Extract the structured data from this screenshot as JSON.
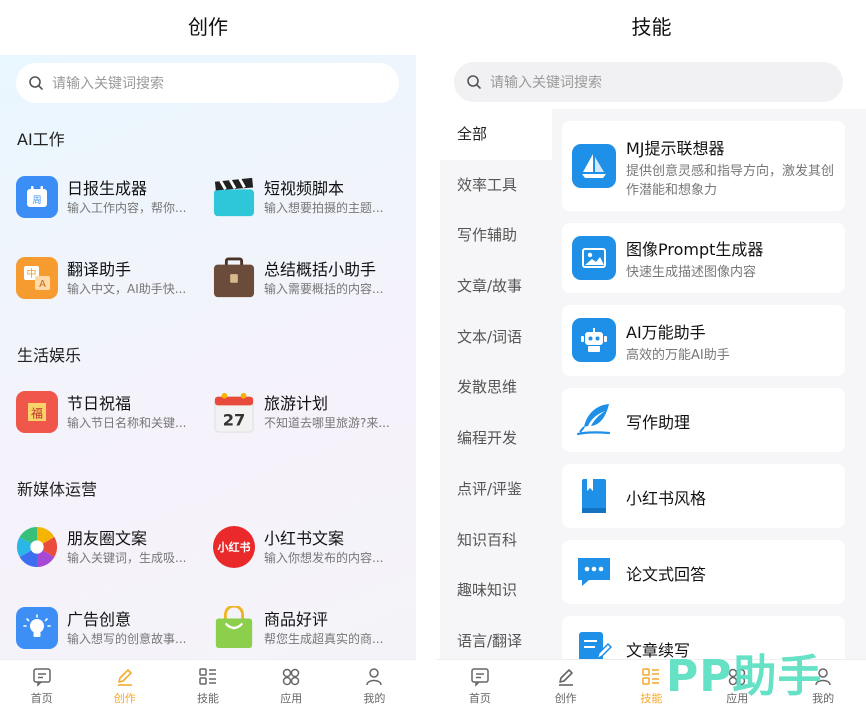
{
  "left": {
    "title": "创作",
    "search_placeholder": "请输入关键词搜索",
    "sections": [
      {
        "title": "AI工作",
        "items": [
          {
            "name": "日报生成器",
            "desc": "输入工作内容，帮你...",
            "icon": "calendar-week-icon",
            "color": "#3a8ef6"
          },
          {
            "name": "短视频脚本",
            "desc": "输入想要拍摄的主题...",
            "icon": "clapperboard-icon",
            "color": "#2ec6d9"
          },
          {
            "name": "翻译助手",
            "desc": "输入中文，AI助手快...",
            "icon": "translate-icon",
            "color": "#f59b2f"
          },
          {
            "name": "总结概括小助手",
            "desc": "输入需要概括的内容...",
            "icon": "briefcase-icon",
            "color": "#6b4b3a"
          }
        ]
      },
      {
        "title": "生活娱乐",
        "items": [
          {
            "name": "节日祝福",
            "desc": "输入节日名称和关键...",
            "icon": "blessing-icon",
            "color": "#f0564a"
          },
          {
            "name": "旅游计划",
            "desc": "不知道去哪里旅游?来...",
            "icon": "calendar-27-icon",
            "color": "#e84b3c",
            "badge": "27"
          }
        ]
      },
      {
        "title": "新媒体运营",
        "items": [
          {
            "name": "朋友圈文案",
            "desc": "输入关键词，生成吸...",
            "icon": "aperture-icon",
            "color": "#f4b400"
          },
          {
            "name": "小红书文案",
            "desc": "输入你想发布的内容...",
            "icon": "xiaohongshu-icon",
            "color": "#ea2a2a",
            "badge": "小红书"
          },
          {
            "name": "广告创意",
            "desc": "输入想写的创意故事...",
            "icon": "lightbulb-icon",
            "color": "#3d8ff5"
          },
          {
            "name": "商品好评",
            "desc": "帮您生成超真实的商...",
            "icon": "shopping-bag-icon",
            "color": "#8ccf4d"
          }
        ]
      }
    ]
  },
  "right": {
    "title": "技能",
    "search_placeholder": "请输入关键词搜索",
    "categories": [
      "全部",
      "效率工具",
      "写作辅助",
      "文章/故事",
      "文本/词语",
      "发散思维",
      "编程开发",
      "点评/评鉴",
      "知识百科",
      "趣味知识",
      "语言/翻译"
    ],
    "active_category": "全部",
    "skills": [
      {
        "name": "MJ提示联想器",
        "desc": "提供创意灵感和指导方向，激发其创作潜能和想象力",
        "icon": "sailboat-icon"
      },
      {
        "name": "图像Prompt生成器",
        "desc": "快速生成描述图像内容",
        "icon": "image-icon"
      },
      {
        "name": "AI万能助手",
        "desc": "高效的万能AI助手",
        "icon": "robot-icon"
      },
      {
        "name": "写作助理",
        "desc": "",
        "icon": "feather-icon"
      },
      {
        "name": "小红书风格",
        "desc": "",
        "icon": "book-icon"
      },
      {
        "name": "论文式回答",
        "desc": "",
        "icon": "chat-icon"
      },
      {
        "name": "文章续写",
        "desc": "",
        "icon": "edit-document-icon"
      }
    ]
  },
  "tabbar": [
    {
      "label": "首页",
      "icon": "home-message-icon"
    },
    {
      "label": "创作",
      "icon": "pencil-icon"
    },
    {
      "label": "技能",
      "icon": "skills-grid-icon"
    },
    {
      "label": "应用",
      "icon": "apps-clover-icon"
    },
    {
      "label": "我的",
      "icon": "person-icon"
    }
  ],
  "left_active_tab": "创作",
  "right_active_tab": "技能",
  "watermark": "PP助手",
  "colors": {
    "accent": "#f4a92b",
    "blue": "#1e90e8",
    "watermark": "#5de0c4"
  }
}
